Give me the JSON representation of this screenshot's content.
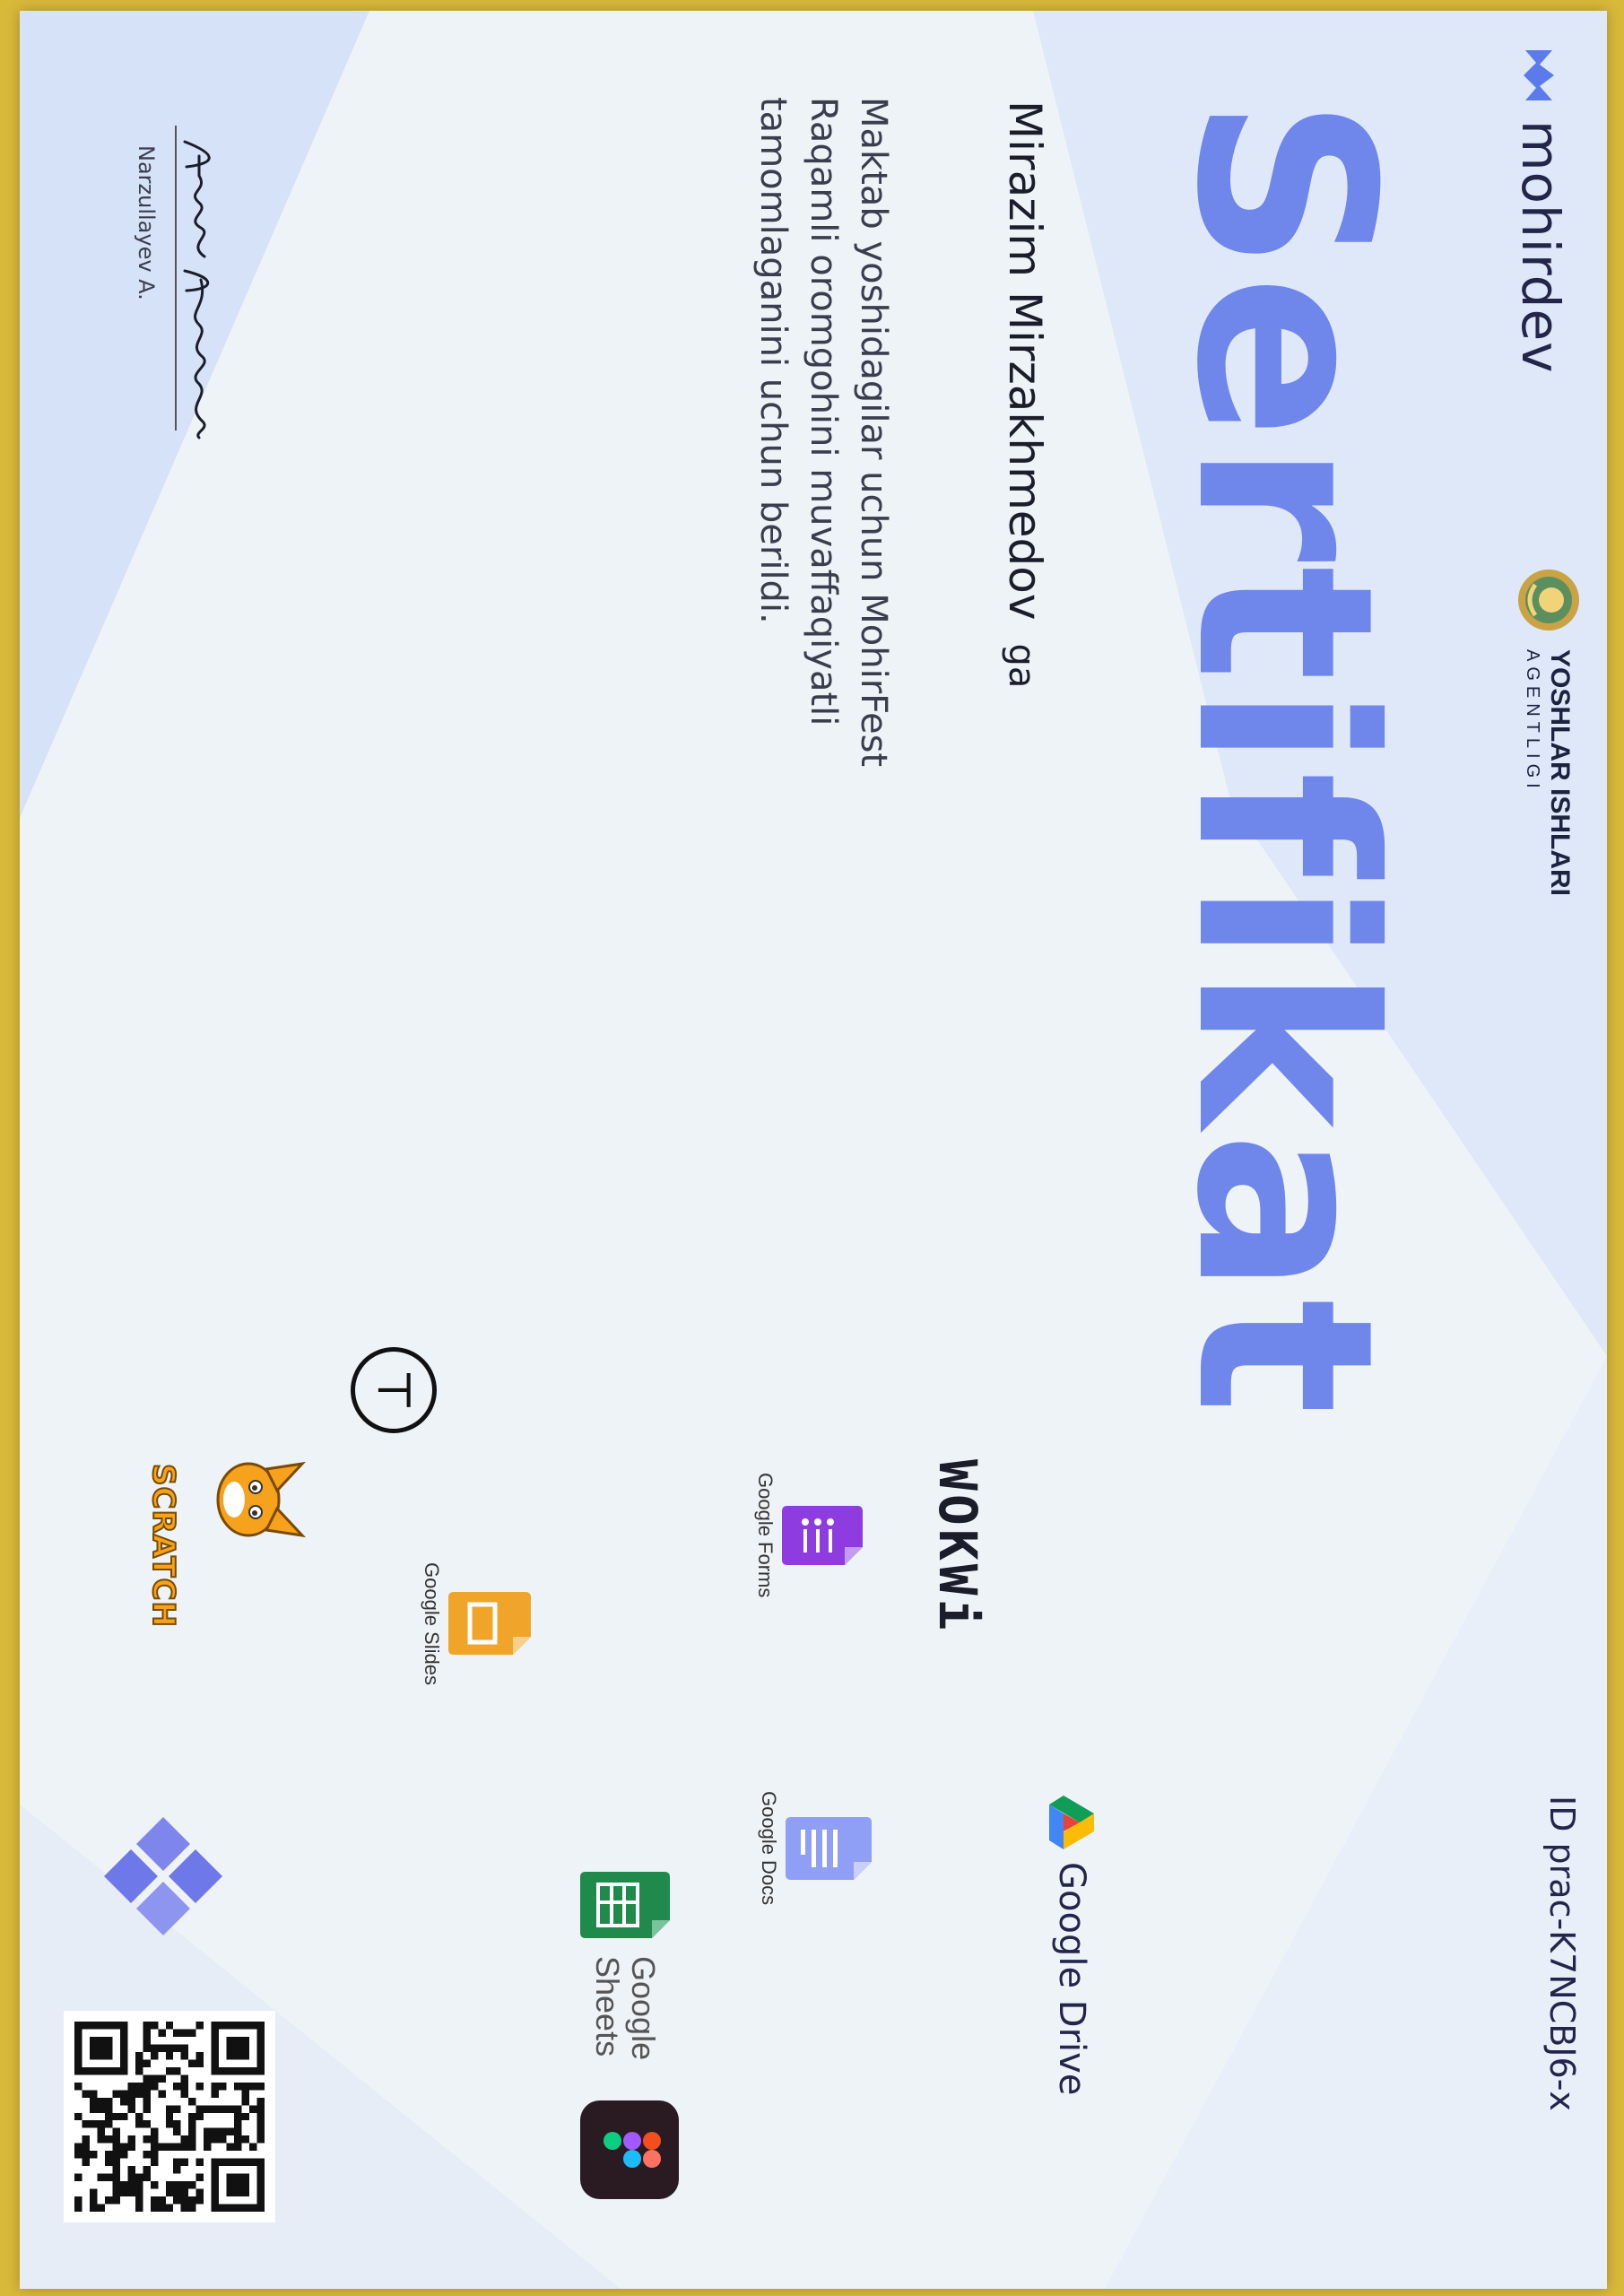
{
  "header": {
    "brand_name": "mohirdev",
    "partner_title": "YOSHLAR ISHLARI",
    "partner_subtitle": "AGENTLIGI",
    "certificate_id": "ID prac-K7NCBJ6-x"
  },
  "certificate": {
    "title": "Sertifikat",
    "recipient_name": "Mirazim Mirzakhmedov",
    "recipient_suffix": "ga",
    "description": "Maktab yoshidagilar uchun MohirFest Raqamli oromgohini muvaffaqiyatli tamomlaganini uchun berildi."
  },
  "signature": {
    "handwritten": "Anvar Narzullayev",
    "signer_name": "Narzullayev A."
  },
  "tools": {
    "google_drive": "Google Drive",
    "google_docs": "Google Docs",
    "google_sheets_line1": "Google",
    "google_sheets_line2": "Sheets",
    "google_forms": "Google Forms",
    "google_slides": "Google Slides",
    "wokwi": "WOKWi",
    "scratch": "SCRATCH"
  },
  "icons": [
    "mohirdev-logo-icon",
    "yoshlar-emblem-icon",
    "google-drive-icon",
    "google-docs-icon",
    "google-sheets-icon",
    "google-forms-icon",
    "google-slides-icon",
    "figma-icon",
    "tinkercad-icon",
    "scratch-cat-icon",
    "diamond-cluster-icon",
    "qr-code"
  ],
  "colors": {
    "title": "#6f86eb",
    "paper": "#eef3f7",
    "text_dark": "#1b1d2b"
  }
}
